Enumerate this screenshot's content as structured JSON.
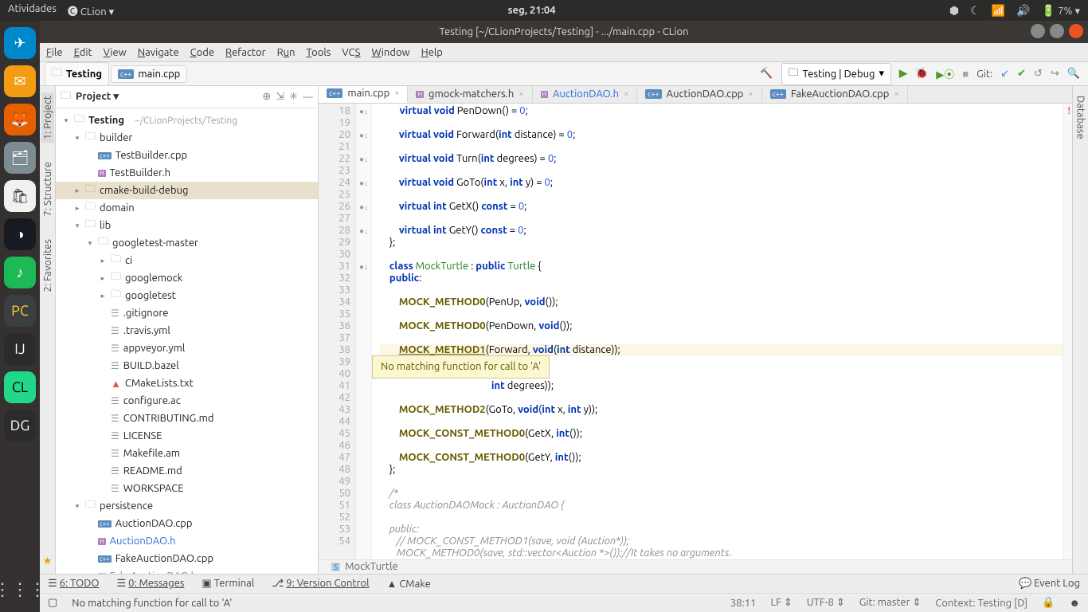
{
  "system": {
    "activities": "Atividades",
    "app": "CLion ▾",
    "clock": "seg, 21:04",
    "battery": "7% ▾"
  },
  "window": {
    "title": "Testing [~/CLionProjects/Testing] - .../main.cpp - CLion"
  },
  "menu": {
    "file": "File",
    "edit": "Edit",
    "view": "View",
    "navigate": "Navigate",
    "code": "Code",
    "refactor": "Refactor",
    "run": "Run",
    "tools": "Tools",
    "vcs": "VCS",
    "window": "Window",
    "help": "Help"
  },
  "crumbs": {
    "root": "Testing",
    "file": "main.cpp"
  },
  "runconf": "Testing | Debug",
  "gitlabel": "Git:",
  "projecthead": "Project",
  "tree": {
    "root": "Testing",
    "rootpath": "~/CLionProjects/Testing",
    "builder": "builder",
    "tb_cpp": "TestBuilder.cpp",
    "tb_h": "TestBuilder.h",
    "cmbd": "cmake-build-debug",
    "domain": "domain",
    "lib": "lib",
    "gtm": "googletest-master",
    "ci": "ci",
    "gmock": "googlemock",
    "gtest": "googletest",
    "gitignore": ".gitignore",
    "travis": ".travis.yml",
    "appveyor": "appveyor.yml",
    "bazel": "BUILD.bazel",
    "cmakelists": "CMakeLists.txt",
    "configure": "configure.ac",
    "contrib": "CONTRIBUTING.md",
    "license": "LICENSE",
    "makefile": "Makefile.am",
    "readme": "README.md",
    "workspace": "WORKSPACE",
    "persistence": "persistence",
    "adao_cpp": "AuctionDAO.cpp",
    "adao_h": "AuctionDAO.h",
    "fadao_cpp": "FakeAuctionDAO.cpp",
    "fadao_h": "FakeAuctionDAO.h"
  },
  "etabs": {
    "t1": "main.cpp",
    "t2": "gmock-matchers.h",
    "t3": "AuctionDAO.h",
    "t4": "AuctionDAO.cpp",
    "t5": "FakeAuctionDAO.cpp"
  },
  "lines": {
    "start": 18,
    "end": 54
  },
  "code": {
    "l18": "        virtual void PenDown() = 0;",
    "l20": "        virtual void Forward(int distance) = 0;",
    "l22": "        virtual void Turn(int degrees) = 0;",
    "l24": "        virtual void GoTo(int x, int y) = 0;",
    "l26": "        virtual int GetX() const = 0;",
    "l28": "        virtual int GetY() const = 0;",
    "l29": "    };",
    "l31": "    class MockTurtle : public Turtle {",
    "l32": "    public:",
    "l34": "        MOCK_METHOD0(PenUp, void());",
    "l36": "        MOCK_METHOD0(PenDown, void());",
    "l38": "        MOCK_METHOD1(Forward, void(int distance));",
    "l40_tail": "int degrees));",
    "l42": "        MOCK_METHOD2(GoTo, void(int x, int y));",
    "l44": "        MOCK_CONST_METHOD0(GetX, int());",
    "l46": "        MOCK_CONST_METHOD0(GetY, int());",
    "l47": "    };",
    "l49": "    /*",
    "l50": "    class AuctionDAOMock : AuctionDAO {",
    "l52": "    public:",
    "l53": "       // MOCK_CONST_METHOD1(save, void (Auction*));",
    "l54": "       MOCK_METHOD0(save, std::vector<Auction *>());//It takes no arguments."
  },
  "tooltip": "No matching function for call to 'A'",
  "breadcrumb2": "MockTurtle",
  "bottomtools": {
    "todo": "6: TODO",
    "messages": "0: Messages",
    "terminal": "Terminal",
    "vcs": "9: Version Control",
    "cmake": "CMake",
    "eventlog": "Event Log"
  },
  "status": {
    "msg": "No matching function for call to 'A'",
    "pos": "38:11",
    "lf": "LF",
    "enc": "UTF-8",
    "git": "Git: master",
    "context": "Context: Testing [D]"
  },
  "sidetabs": {
    "project": "1: Project",
    "structure": "7: Structure",
    "favorites": "2: Favorites",
    "database": "Database"
  }
}
